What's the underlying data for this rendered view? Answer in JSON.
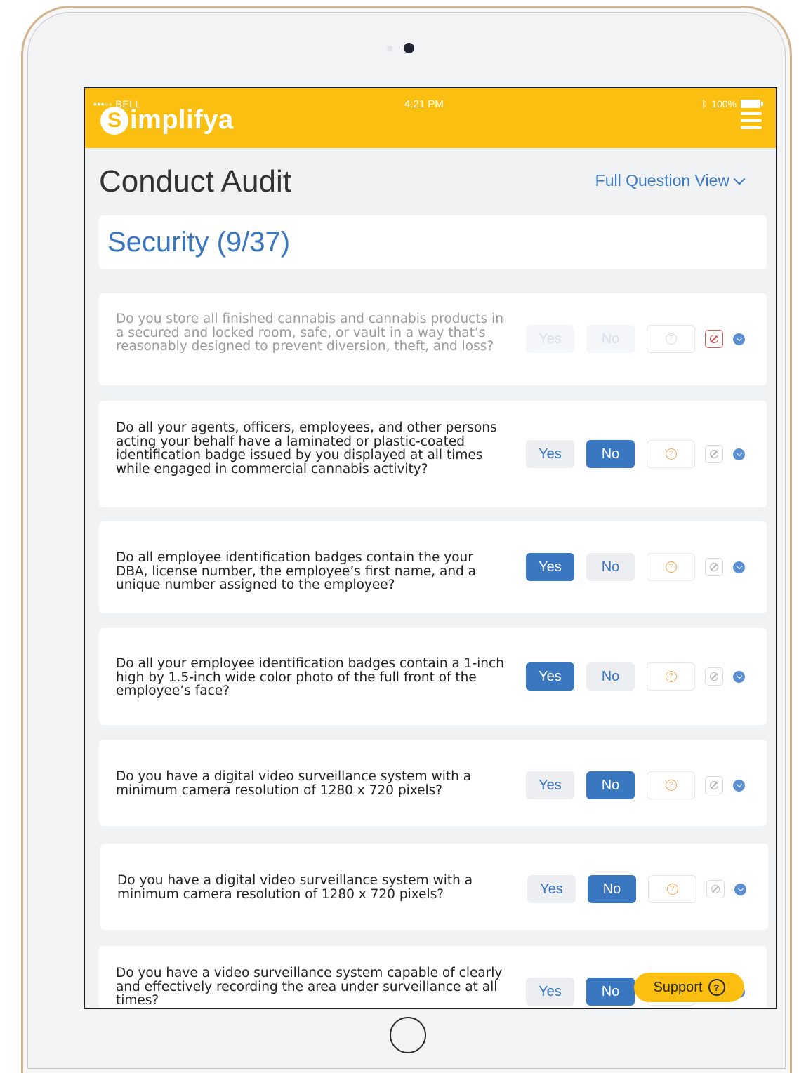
{
  "status_bar": {
    "carrier": "•••◦◦ BELL",
    "time": "4:21 PM",
    "battery": "100%"
  },
  "brand": {
    "logo_initial": "S",
    "logo_text": "implifya"
  },
  "page": {
    "title": "Conduct Audit",
    "view_selector": "Full Question View"
  },
  "section": {
    "title": "Security (9/37)"
  },
  "answer_labels": {
    "yes": "Yes",
    "no": "No"
  },
  "questions": [
    {
      "text": "Do you store all finished cannabis and cannabis products in a secured and locked room, safe, or vault in a way that’s reasonably designed to prevent diversion, theft, and loss?",
      "answer": "na",
      "state": "disabled"
    },
    {
      "text": "Do all your agents, officers, employees, and other persons acting your behalf have a laminated or plastic-coated identification badge issued by you displayed at all times while engaged in commercial cannabis activity?",
      "answer": "no",
      "state": "active"
    },
    {
      "text": "Do all employee identification badges contain the your DBA, license number, the employee’s first name, and a unique number assigned to the employee?",
      "answer": "yes",
      "state": "active"
    },
    {
      "text": "Do all your employee identification badges contain a 1-inch high by 1.5-inch wide color photo of the full front of the employee’s face?",
      "answer": "yes",
      "state": "active"
    },
    {
      "text": "Do you have a digital video surveillance system with a minimum camera resolution of 1280 x 720 pixels?",
      "answer": "no",
      "state": "active"
    },
    {
      "text": "Do you have a digital video surveillance system with a minimum camera resolution of 1280 x 720 pixels?",
      "answer": "no",
      "state": "active"
    },
    {
      "text": "Do you have a video surveillance system capable of clearly and effectively recording the area under surveillance at all times?",
      "answer": "no",
      "state": "active"
    }
  ],
  "support": {
    "label": "Support"
  },
  "colors": {
    "brand_yellow": "#fbbf12",
    "accent_blue": "#3a77c1",
    "unknown_orange": "#f2a654",
    "na_red": "#e25353"
  }
}
